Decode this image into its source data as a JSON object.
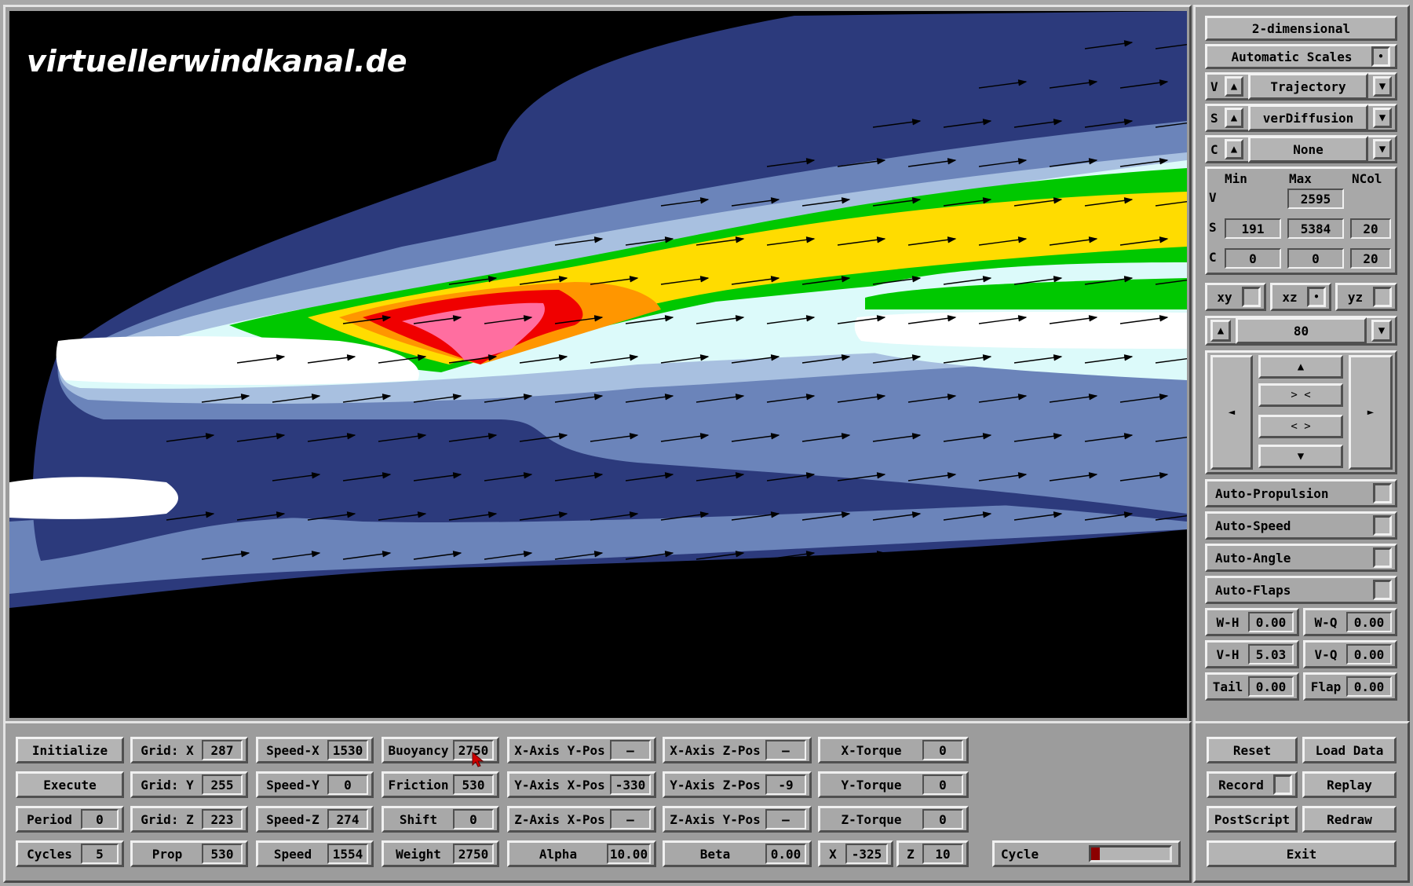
{
  "watermark": "virtuellerwindkanal.de",
  "right_panel": {
    "mode": "2-dimensional",
    "scales": "Automatic Scales",
    "selectors": [
      {
        "key": "V",
        "value": "Trajectory"
      },
      {
        "key": "S",
        "value": "verDiffusion"
      },
      {
        "key": "C",
        "value": "None"
      }
    ],
    "range_headers": {
      "min": "Min",
      "max": "Max",
      "ncol": "NCol"
    },
    "range_rows": {
      "v": {
        "label": "V",
        "max": "2595"
      },
      "s": {
        "label": "S",
        "min": "191",
        "max": "5384",
        "ncol": "20"
      },
      "c": {
        "label": "C",
        "min": "0",
        "max": "0",
        "ncol": "20"
      }
    },
    "planes": [
      "xy",
      "xz",
      "yz"
    ],
    "plane_selected": "xz",
    "slice_value": "80",
    "nav": {
      "left": "◄",
      "right": "►",
      "up": "▲",
      "in": "> <",
      "out": "< >",
      "down": "▼"
    },
    "toggles": [
      "Auto-Propulsion",
      "Auto-Speed",
      "Auto-Angle",
      "Auto-Flaps"
    ],
    "params": [
      [
        {
          "label": "W-H",
          "value": "0.00"
        },
        {
          "label": "W-Q",
          "value": "0.00"
        }
      ],
      [
        {
          "label": "V-H",
          "value": "5.03"
        },
        {
          "label": "V-Q",
          "value": "0.00"
        }
      ],
      [
        {
          "label": "Tail",
          "value": "0.00"
        },
        {
          "label": "Flap",
          "value": "0.00"
        }
      ]
    ]
  },
  "bottom": {
    "row1": {
      "b1": {
        "label": "Initialize"
      },
      "c2": {
        "label": "Grid: X",
        "value": "287"
      },
      "c3": {
        "label": "Speed-X",
        "value": "1530"
      },
      "c4": {
        "label": "Buoyancy",
        "value": "2750"
      },
      "c5": {
        "label": "X-Axis Y-Pos",
        "value": "—"
      },
      "c6": {
        "label": "X-Axis Z-Pos",
        "value": "—"
      },
      "c7": {
        "label": "X-Torque",
        "value": "0"
      }
    },
    "row2": {
      "b1": {
        "label": "Execute"
      },
      "c2": {
        "label": "Grid: Y",
        "value": "255"
      },
      "c3": {
        "label": "Speed-Y",
        "value": "0"
      },
      "c4": {
        "label": "Friction",
        "value": "530"
      },
      "c5": {
        "label": "Y-Axis X-Pos",
        "value": "-330"
      },
      "c6": {
        "label": "Y-Axis Z-Pos",
        "value": "-9"
      },
      "c7": {
        "label": "Y-Torque",
        "value": "0"
      }
    },
    "row3": {
      "c1": {
        "label": "Period",
        "value": "0"
      },
      "c2": {
        "label": "Grid: Z",
        "value": "223"
      },
      "c3": {
        "label": "Speed-Z",
        "value": "274"
      },
      "c4": {
        "label": "Shift",
        "value": "0"
      },
      "c5": {
        "label": "Z-Axis X-Pos",
        "value": "—"
      },
      "c6": {
        "label": "Z-Axis Y-Pos",
        "value": "—"
      },
      "c7": {
        "label": "Z-Torque",
        "value": "0"
      }
    },
    "row4": {
      "c1": {
        "label": "Cycles",
        "value": "5"
      },
      "c2": {
        "label": "Prop",
        "value": "530"
      },
      "c3": {
        "label": "Speed",
        "value": "1554"
      },
      "c4": {
        "label": "Weight",
        "value": "2750"
      },
      "c5": {
        "label": "Alpha",
        "value": "10.00"
      },
      "c6": {
        "label": "Beta",
        "value": "0.00"
      },
      "x": {
        "label": "X",
        "value": "-325"
      },
      "z": {
        "label": "Z",
        "value": "10"
      },
      "cycle": {
        "label": "Cycle",
        "progress": 0.11
      }
    },
    "actions": {
      "reset": "Reset",
      "load": "Load Data",
      "record": "Record",
      "replay": "Replay",
      "postscript": "PostScript",
      "redraw": "Redraw",
      "exit": "Exit"
    }
  },
  "colors": {
    "background": "#000000",
    "navy": "#2c3a7c",
    "mid_blue": "#6b84ba",
    "light_blue": "#a8c0e0",
    "cyan": "#dcfafa",
    "green": "#00c800",
    "yellow": "#ffdc00",
    "orange": "#ff9600",
    "red": "#f00000",
    "pink": "#ff6ea0",
    "progress": "#8c0000"
  }
}
